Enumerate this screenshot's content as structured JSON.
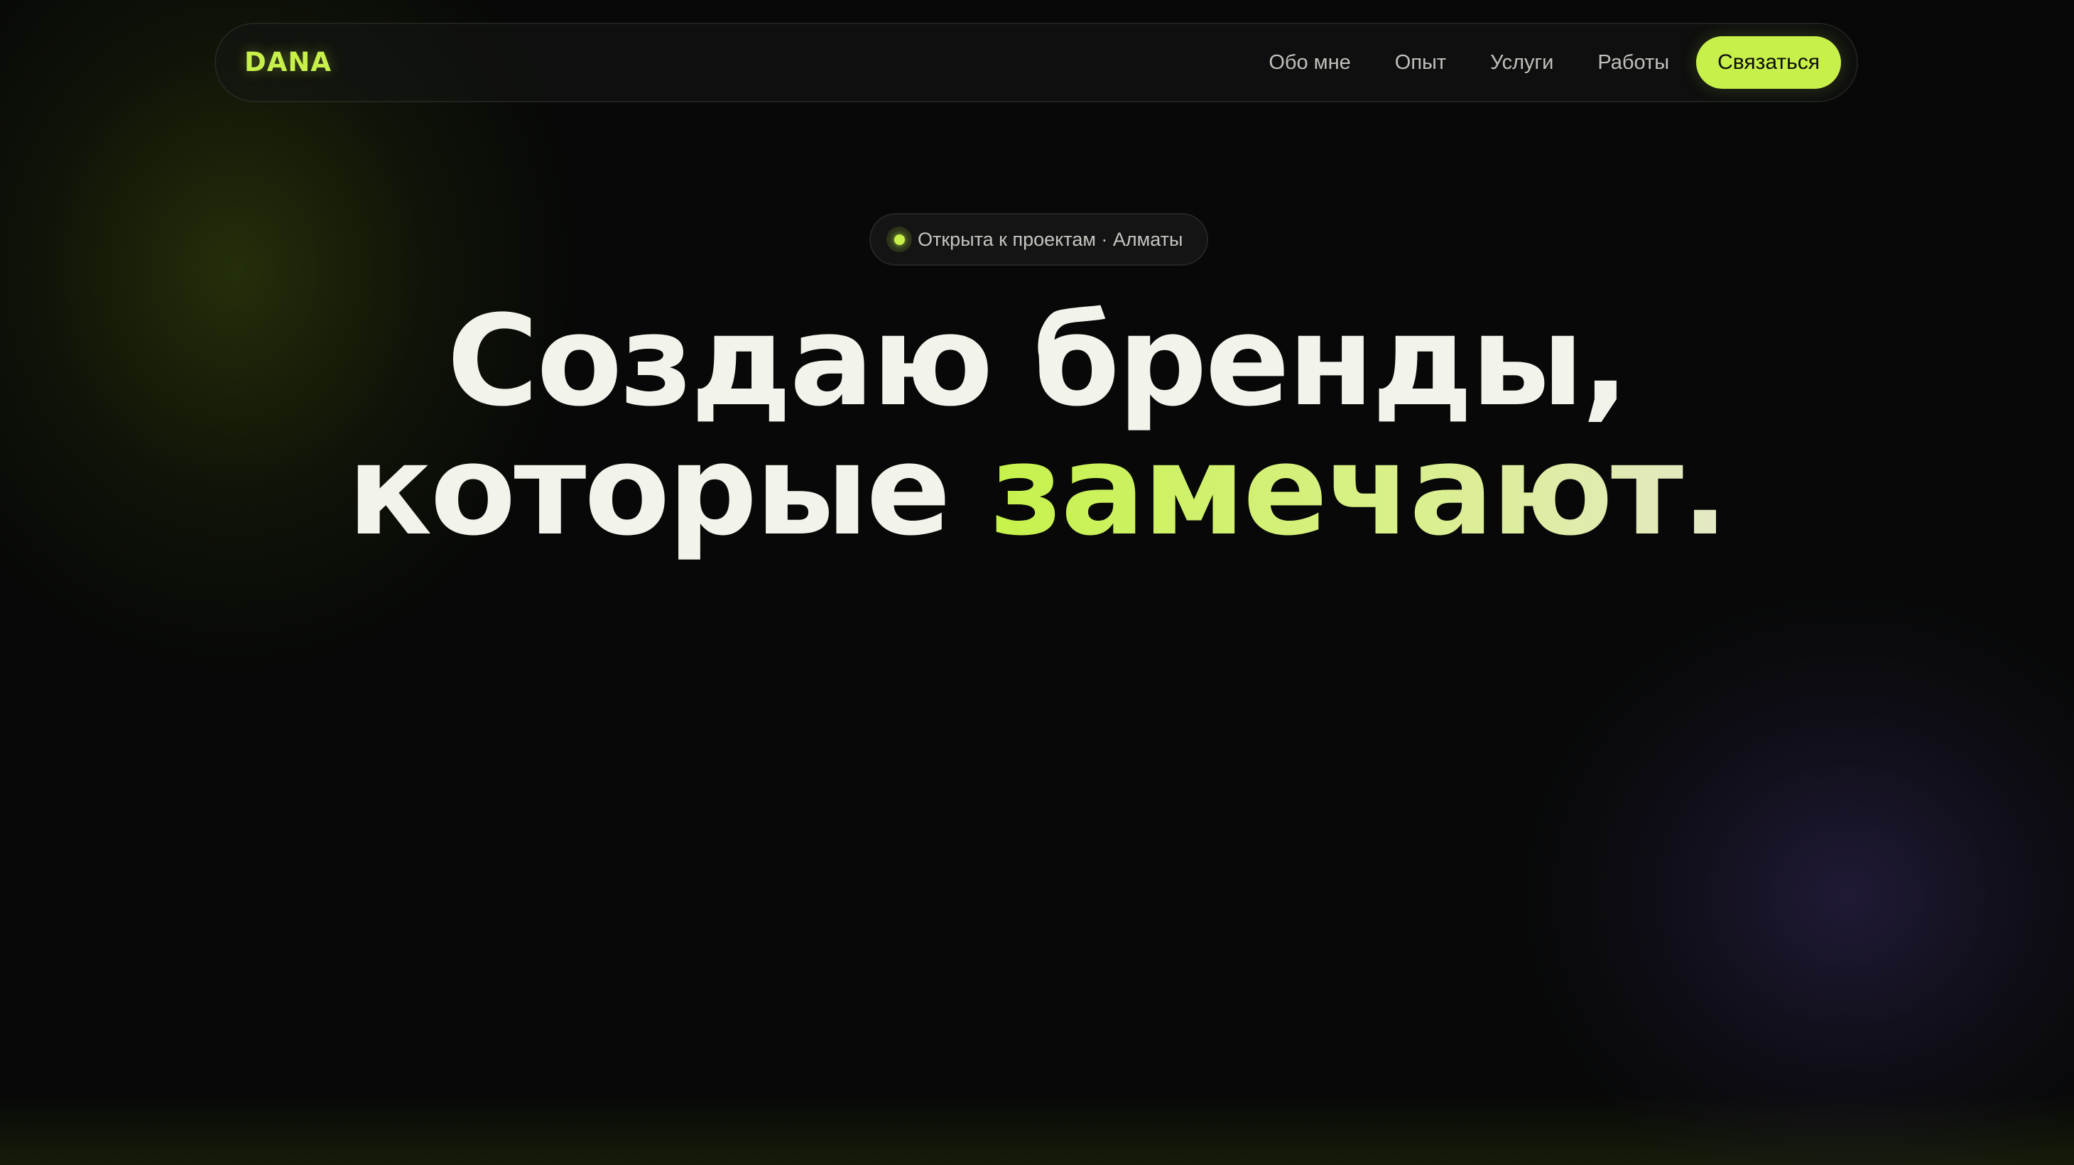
{
  "brand": {
    "logo": "DANA",
    "accent_color": "#c8f04a",
    "background_color": "#070807"
  },
  "nav": {
    "links": [
      {
        "label": "Обо мне"
      },
      {
        "label": "Опыт"
      },
      {
        "label": "Услуги"
      },
      {
        "label": "Работы"
      }
    ],
    "cta_label": "Связаться"
  },
  "hero": {
    "status": {
      "icon": "status-dot-icon",
      "text": "Открыта к проектам · Алматы"
    },
    "headline_line1": "Создаю бренды,",
    "headline_line2_plain": "которые ",
    "headline_line2_accent": "замечают."
  }
}
